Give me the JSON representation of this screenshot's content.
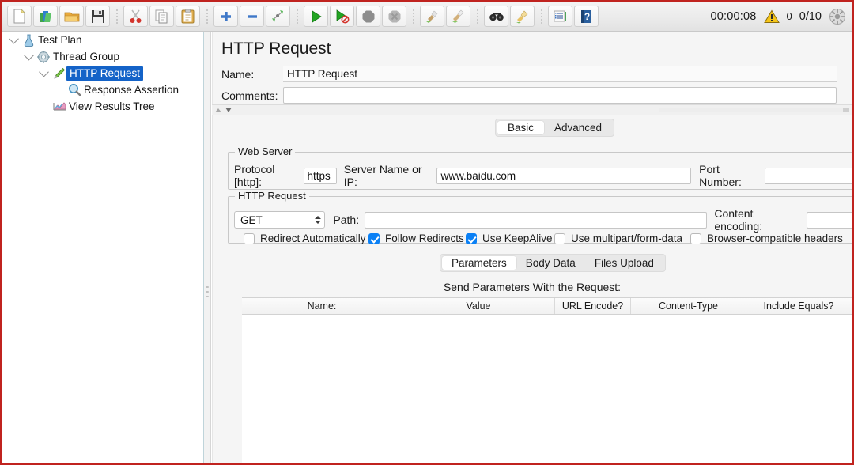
{
  "toolbar": {
    "buttons": [
      {
        "name": "new-icon",
        "label": "New"
      },
      {
        "name": "templates-icon",
        "label": "Templates"
      },
      {
        "name": "open-icon",
        "label": "Open"
      },
      {
        "name": "save-icon",
        "label": "Save"
      },
      {
        "name": "cut-icon",
        "label": "Cut"
      },
      {
        "name": "copy-icon",
        "label": "Copy"
      },
      {
        "name": "paste-icon",
        "label": "Paste"
      },
      {
        "name": "expand-all-icon",
        "label": "Expand All"
      },
      {
        "name": "collapse-all-icon",
        "label": "Collapse All"
      },
      {
        "name": "toggle-icon",
        "label": "Toggle"
      },
      {
        "name": "start-icon",
        "label": "Start"
      },
      {
        "name": "start-no-timers-icon",
        "label": "Start no pauses"
      },
      {
        "name": "stop-icon",
        "label": "Stop"
      },
      {
        "name": "shutdown-icon",
        "label": "Shutdown"
      },
      {
        "name": "clear-icon",
        "label": "Clear"
      },
      {
        "name": "clear-all-icon",
        "label": "Clear All"
      },
      {
        "name": "search-icon",
        "label": "Search"
      },
      {
        "name": "reset-search-icon",
        "label": "Reset Search"
      },
      {
        "name": "function-helper-icon",
        "label": "Function Helper Dialog"
      },
      {
        "name": "help-icon",
        "label": "Help"
      }
    ],
    "status": {
      "timer": "00:00:08",
      "warning_count": "0",
      "threads": "0/10"
    }
  },
  "tree": {
    "nodes": [
      {
        "label": "Test Plan",
        "icon": "test-plan-icon",
        "depth": 0,
        "expanded": true,
        "selected": false
      },
      {
        "label": "Thread Group",
        "icon": "thread-group-icon",
        "depth": 1,
        "expanded": true,
        "selected": false
      },
      {
        "label": "HTTP Request",
        "icon": "http-request-icon",
        "depth": 2,
        "expanded": true,
        "selected": true
      },
      {
        "label": "Response Assertion",
        "icon": "response-assertion-icon",
        "depth": 3,
        "expanded": false,
        "selected": false
      },
      {
        "label": "View Results Tree",
        "icon": "view-results-tree-icon",
        "depth": 2,
        "expanded": false,
        "selected": false
      }
    ]
  },
  "main": {
    "page_title": "HTTP Request",
    "name_label": "Name:",
    "name_value": "HTTP Request",
    "comments_label": "Comments:",
    "comments_value": "",
    "mode_tabs": [
      {
        "label": "Basic",
        "active": true
      },
      {
        "label": "Advanced",
        "active": false
      }
    ],
    "web_server": {
      "title": "Web Server",
      "protocol_label": "Protocol [http]:",
      "protocol_value": "https",
      "server_label": "Server Name or IP:",
      "server_value": "www.baidu.com",
      "port_label": "Port Number:",
      "port_value": ""
    },
    "http_request": {
      "title": "HTTP Request",
      "method_value": "GET",
      "path_label": "Path:",
      "path_value": "",
      "content_encoding_label": "Content encoding:",
      "content_encoding_value": "",
      "checkboxes": [
        {
          "label": "Redirect Automatically",
          "checked": false
        },
        {
          "label": "Follow Redirects",
          "checked": true
        },
        {
          "label": "Use KeepAlive",
          "checked": true
        },
        {
          "label": "Use multipart/form-data",
          "checked": false
        },
        {
          "label": "Browser-compatible headers",
          "checked": false
        }
      ]
    },
    "param_tabs": [
      {
        "label": "Parameters",
        "active": true
      },
      {
        "label": "Body Data",
        "active": false
      },
      {
        "label": "Files Upload",
        "active": false
      }
    ],
    "send_params_label": "Send Parameters With the Request:",
    "table": {
      "columns": [
        "Name:",
        "Value",
        "URL Encode?",
        "Content-Type",
        "Include Equals?"
      ],
      "rows": []
    }
  },
  "colors": {
    "selection": "#1463c8",
    "checkbox_on": "#0a80f5",
    "frame_border": "#c0231f",
    "toolbar_bg": "#ebebeb"
  }
}
